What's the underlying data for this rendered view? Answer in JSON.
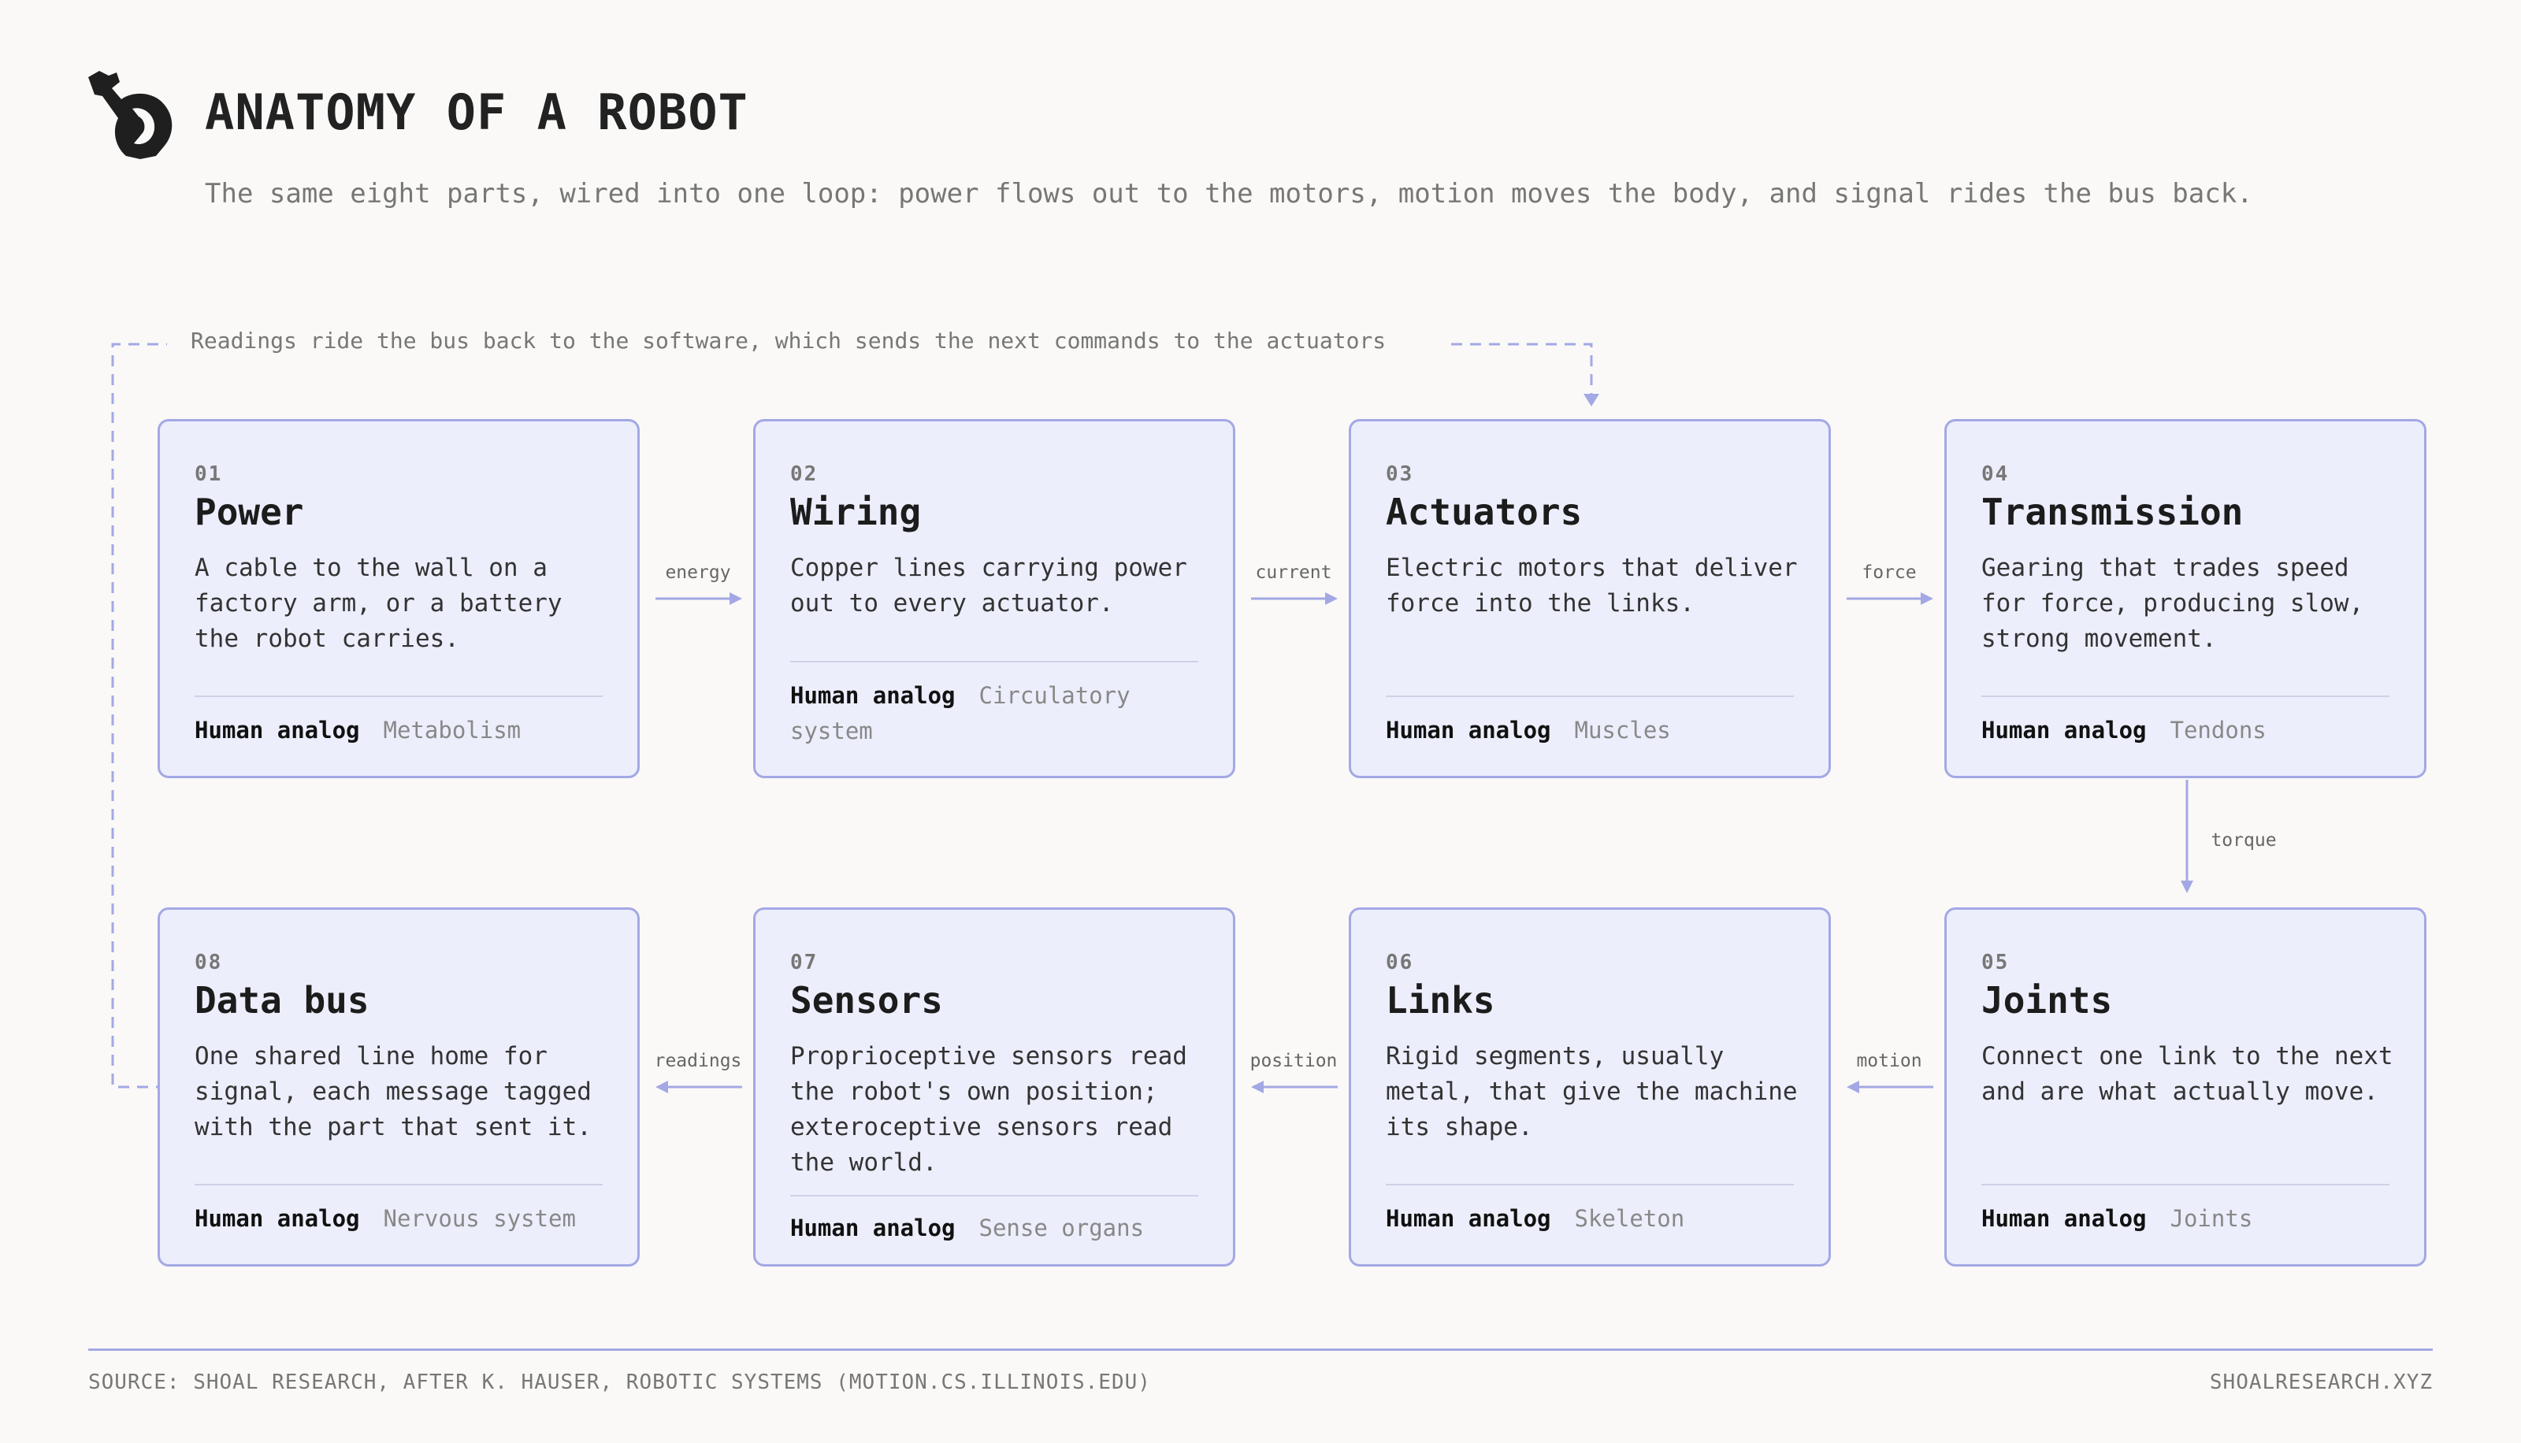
{
  "header": {
    "title": "ANATOMY OF A ROBOT",
    "subtitle": "The same eight parts, wired into one loop: power flows out to the motors, motion moves the body, and signal rides the bus back."
  },
  "loop_note": "Readings ride the bus back to the software, which sends the next commands to the actuators",
  "analog_label": "Human analog",
  "parts": [
    {
      "num": "01",
      "name": "Power",
      "desc": "A cable to the wall on a factory arm, or a battery the robot carries.",
      "analog": "Metabolism"
    },
    {
      "num": "02",
      "name": "Wiring",
      "desc": "Copper lines carrying power out to every actuator.",
      "analog": "Circulatory system"
    },
    {
      "num": "03",
      "name": "Actuators",
      "desc": "Electric motors that deliver force into the links.",
      "analog": "Muscles"
    },
    {
      "num": "04",
      "name": "Transmission",
      "desc": "Gearing that trades speed for force, producing slow, strong movement.",
      "analog": "Tendons"
    },
    {
      "num": "05",
      "name": "Joints",
      "desc": "Connect one link to the next and are what actually move.",
      "analog": "Joints"
    },
    {
      "num": "06",
      "name": "Links",
      "desc": "Rigid segments, usually metal, that give the machine its shape.",
      "analog": "Skeleton"
    },
    {
      "num": "07",
      "name": "Sensors",
      "desc": "Proprioceptive sensors read the robot's own position; exteroceptive sensors read the world.",
      "analog": "Sense organs"
    },
    {
      "num": "08",
      "name": "Data bus",
      "desc": "One shared line home for signal, each message tagged with the part that sent it.",
      "analog": "Nervous system"
    }
  ],
  "flows": {
    "energy": "energy",
    "current": "current",
    "force": "force",
    "torque": "torque",
    "motion": "motion",
    "position": "position",
    "readings": "readings"
  },
  "colors": {
    "card_fill": "#eceefc",
    "card_border": "#a3a8e4",
    "arrow": "#a3a8e4",
    "background": "#faf9f7"
  },
  "footer": {
    "source": "SOURCE: SHOAL RESEARCH, AFTER K. HAUSER, ROBOTIC SYSTEMS (MOTION.CS.ILLINOIS.EDU)",
    "site": "SHOALRESEARCH.XYZ"
  }
}
